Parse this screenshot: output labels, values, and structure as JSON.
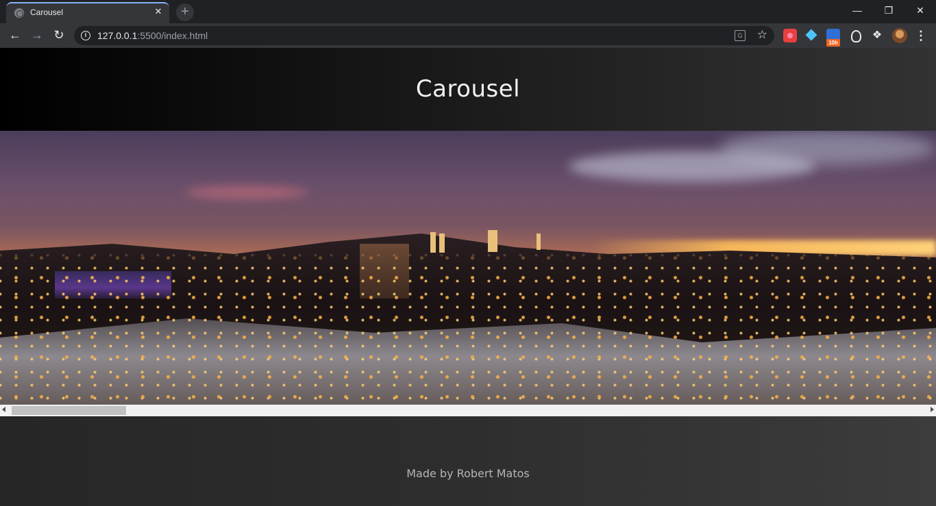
{
  "browser": {
    "tab_title": "Carousel",
    "tab_close": "✕",
    "new_tab": "+",
    "url_host": "127.0.0.1",
    "url_rest": ":5500/index.html",
    "ext_badge": "10h",
    "window_controls": {
      "minimize": "—",
      "maximize": "❐",
      "close": "✕"
    }
  },
  "page": {
    "heading": "Carousel",
    "footer_text": "Made by Robert Matos"
  },
  "carousel": {
    "slide_description_icon": "landscape-photo"
  },
  "colors": {
    "accent_tab": "#8ab4f8",
    "page_header_bg": "#000000",
    "footer_bg": "#2e2e2e",
    "scrollbar_thumb": "#c1c1c1"
  }
}
